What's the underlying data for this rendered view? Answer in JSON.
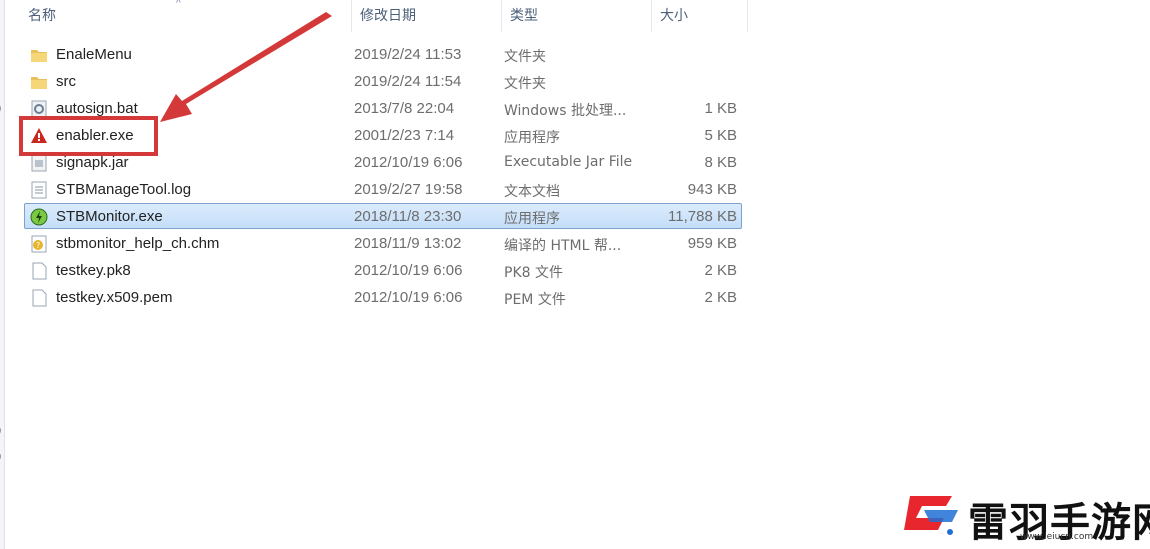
{
  "columns": {
    "name": "名称",
    "date": "修改日期",
    "type": "类型",
    "size": "大小"
  },
  "files": [
    {
      "name": "EnaleMenu",
      "date": "2019/2/24 11:53",
      "type": "文件夹",
      "size": "",
      "icon": "folder-icon"
    },
    {
      "name": "src",
      "date": "2019/2/24 11:54",
      "type": "文件夹",
      "size": "",
      "icon": "folder-icon"
    },
    {
      "name": "autosign.bat",
      "date": "2013/7/8 22:04",
      "type": "Windows 批处理...",
      "size": "1 KB",
      "icon": "batch-file-icon"
    },
    {
      "name": "enabler.exe",
      "date": "2001/2/23 7:14",
      "type": "应用程序",
      "size": "5 KB",
      "icon": "warning-app-icon"
    },
    {
      "name": "signapk.jar",
      "date": "2012/10/19 6:06",
      "type": "Executable Jar File",
      "size": "8 KB",
      "icon": "jar-file-icon"
    },
    {
      "name": "STBManageTool.log",
      "date": "2019/2/27 19:58",
      "type": "文本文档",
      "size": "943 KB",
      "icon": "text-file-icon"
    },
    {
      "name": "STBMonitor.exe",
      "date": "2018/11/8 23:30",
      "type": "应用程序",
      "size": "11,788 KB",
      "icon": "monitor-app-icon",
      "selected": true
    },
    {
      "name": "stbmonitor_help_ch.chm",
      "date": "2018/11/9 13:02",
      "type": "编译的 HTML 帮...",
      "size": "959 KB",
      "icon": "help-file-icon"
    },
    {
      "name": "testkey.pk8",
      "date": "2012/10/19 6:06",
      "type": "PK8 文件",
      "size": "2 KB",
      "icon": "blank-file-icon"
    },
    {
      "name": "testkey.x509.pem",
      "date": "2012/10/19 6:06",
      "type": "PEM 文件",
      "size": "2 KB",
      "icon": "blank-file-icon"
    }
  ],
  "brand": {
    "name": "雷羽手游网",
    "url": "www.leiucn.com"
  },
  "colors": {
    "annotation": "#d4393a",
    "selection": "#cce4fb",
    "brand_red": "#e8262d",
    "brand_blue": "#1f6fd6"
  }
}
